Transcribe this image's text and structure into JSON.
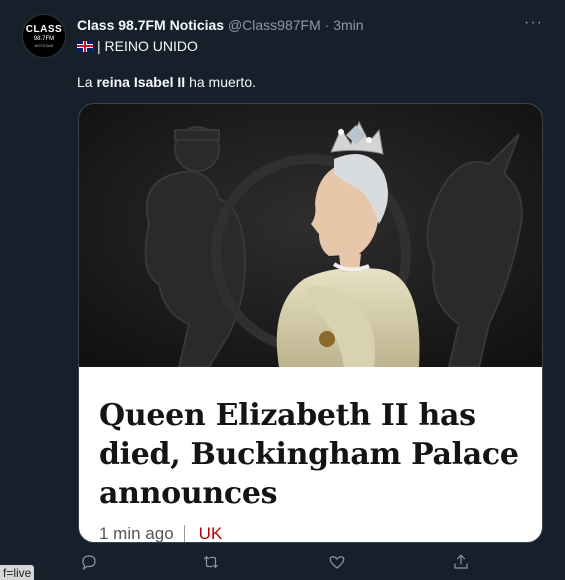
{
  "avatar": {
    "line1": "CLASS",
    "line2": "98.7FM",
    "line3": "NOTICIAS"
  },
  "header": {
    "name": "Class 98.7FM Noticias",
    "handle": "@Class987FM",
    "dot": "·",
    "time": "3min",
    "more": "···"
  },
  "subline": {
    "text": "| REINO UNIDO"
  },
  "tweet": {
    "text_before": "La ",
    "text_bold": "reina Isabel II",
    "text_after": " ha muerto."
  },
  "card": {
    "headline": "Queen Elizabeth II has died, Buckingham Palace announces",
    "time": "1 min ago",
    "section": "UK"
  },
  "actions": {
    "icons": [
      "reply-icon",
      "retweet-icon",
      "like-icon",
      "share-icon"
    ]
  },
  "status_overlay": {
    "text": "f=live"
  },
  "colors": {
    "background": "#15202b",
    "text": "#f7f9f9",
    "muted": "#8b98a5",
    "card_section": "#b80000"
  }
}
